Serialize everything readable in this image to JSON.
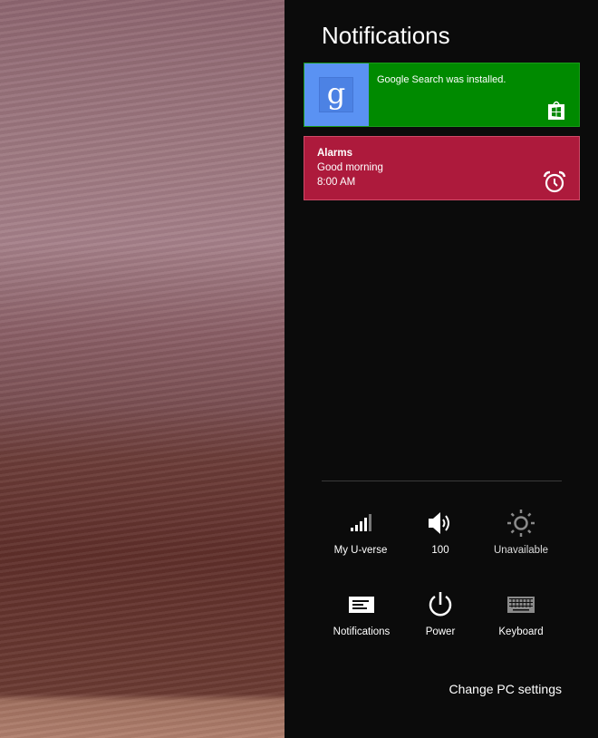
{
  "panel": {
    "title": "Notifications"
  },
  "notifications": [
    {
      "app": "Google Search",
      "message": "Google Search was installed.",
      "logo_letter": "g",
      "color": "#008a00",
      "icon": "store-icon"
    },
    {
      "title": "Alarms",
      "body": "Good morning",
      "time": "8:00 AM",
      "color": "#ad1a3c",
      "icon": "alarm-clock-icon"
    }
  ],
  "quick_actions": [
    {
      "label": "My U-verse",
      "icon": "wifi-signal-icon"
    },
    {
      "label": "100",
      "icon": "volume-icon"
    },
    {
      "label": "Unavailable",
      "icon": "brightness-icon"
    },
    {
      "label": "Notifications",
      "icon": "notifications-icon"
    },
    {
      "label": "Power",
      "icon": "power-icon"
    },
    {
      "label": "Keyboard",
      "icon": "keyboard-icon"
    }
  ],
  "footer": {
    "change_settings": "Change PC settings"
  }
}
